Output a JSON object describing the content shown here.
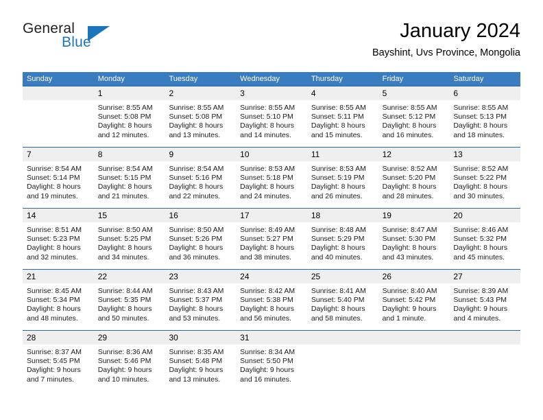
{
  "brand": {
    "word_one": "General",
    "word_two": "Blue",
    "triangle_icon": "triangle-icon"
  },
  "header": {
    "title": "January 2024",
    "subtitle": "Bayshint, Uvs Province, Mongolia"
  },
  "colors": {
    "header_blue": "#3a7cc0",
    "row_border_blue": "#2b6ca8",
    "day_number_bg": "#efefef",
    "brand_blue": "#1b75bb"
  },
  "weekdays": [
    "Sunday",
    "Monday",
    "Tuesday",
    "Wednesday",
    "Thursday",
    "Friday",
    "Saturday"
  ],
  "weeks": [
    [
      {
        "day": "",
        "sunrise": "",
        "sunset": "",
        "daylight_line1": "",
        "daylight_line2": ""
      },
      {
        "day": "1",
        "sunrise": "Sunrise: 8:55 AM",
        "sunset": "Sunset: 5:08 PM",
        "daylight_line1": "Daylight: 8 hours",
        "daylight_line2": "and 12 minutes."
      },
      {
        "day": "2",
        "sunrise": "Sunrise: 8:55 AM",
        "sunset": "Sunset: 5:08 PM",
        "daylight_line1": "Daylight: 8 hours",
        "daylight_line2": "and 13 minutes."
      },
      {
        "day": "3",
        "sunrise": "Sunrise: 8:55 AM",
        "sunset": "Sunset: 5:10 PM",
        "daylight_line1": "Daylight: 8 hours",
        "daylight_line2": "and 14 minutes."
      },
      {
        "day": "4",
        "sunrise": "Sunrise: 8:55 AM",
        "sunset": "Sunset: 5:11 PM",
        "daylight_line1": "Daylight: 8 hours",
        "daylight_line2": "and 15 minutes."
      },
      {
        "day": "5",
        "sunrise": "Sunrise: 8:55 AM",
        "sunset": "Sunset: 5:12 PM",
        "daylight_line1": "Daylight: 8 hours",
        "daylight_line2": "and 16 minutes."
      },
      {
        "day": "6",
        "sunrise": "Sunrise: 8:55 AM",
        "sunset": "Sunset: 5:13 PM",
        "daylight_line1": "Daylight: 8 hours",
        "daylight_line2": "and 18 minutes."
      }
    ],
    [
      {
        "day": "7",
        "sunrise": "Sunrise: 8:54 AM",
        "sunset": "Sunset: 5:14 PM",
        "daylight_line1": "Daylight: 8 hours",
        "daylight_line2": "and 19 minutes."
      },
      {
        "day": "8",
        "sunrise": "Sunrise: 8:54 AM",
        "sunset": "Sunset: 5:15 PM",
        "daylight_line1": "Daylight: 8 hours",
        "daylight_line2": "and 21 minutes."
      },
      {
        "day": "9",
        "sunrise": "Sunrise: 8:54 AM",
        "sunset": "Sunset: 5:16 PM",
        "daylight_line1": "Daylight: 8 hours",
        "daylight_line2": "and 22 minutes."
      },
      {
        "day": "10",
        "sunrise": "Sunrise: 8:53 AM",
        "sunset": "Sunset: 5:18 PM",
        "daylight_line1": "Daylight: 8 hours",
        "daylight_line2": "and 24 minutes."
      },
      {
        "day": "11",
        "sunrise": "Sunrise: 8:53 AM",
        "sunset": "Sunset: 5:19 PM",
        "daylight_line1": "Daylight: 8 hours",
        "daylight_line2": "and 26 minutes."
      },
      {
        "day": "12",
        "sunrise": "Sunrise: 8:52 AM",
        "sunset": "Sunset: 5:20 PM",
        "daylight_line1": "Daylight: 8 hours",
        "daylight_line2": "and 28 minutes."
      },
      {
        "day": "13",
        "sunrise": "Sunrise: 8:52 AM",
        "sunset": "Sunset: 5:22 PM",
        "daylight_line1": "Daylight: 8 hours",
        "daylight_line2": "and 30 minutes."
      }
    ],
    [
      {
        "day": "14",
        "sunrise": "Sunrise: 8:51 AM",
        "sunset": "Sunset: 5:23 PM",
        "daylight_line1": "Daylight: 8 hours",
        "daylight_line2": "and 32 minutes."
      },
      {
        "day": "15",
        "sunrise": "Sunrise: 8:50 AM",
        "sunset": "Sunset: 5:25 PM",
        "daylight_line1": "Daylight: 8 hours",
        "daylight_line2": "and 34 minutes."
      },
      {
        "day": "16",
        "sunrise": "Sunrise: 8:50 AM",
        "sunset": "Sunset: 5:26 PM",
        "daylight_line1": "Daylight: 8 hours",
        "daylight_line2": "and 36 minutes."
      },
      {
        "day": "17",
        "sunrise": "Sunrise: 8:49 AM",
        "sunset": "Sunset: 5:27 PM",
        "daylight_line1": "Daylight: 8 hours",
        "daylight_line2": "and 38 minutes."
      },
      {
        "day": "18",
        "sunrise": "Sunrise: 8:48 AM",
        "sunset": "Sunset: 5:29 PM",
        "daylight_line1": "Daylight: 8 hours",
        "daylight_line2": "and 40 minutes."
      },
      {
        "day": "19",
        "sunrise": "Sunrise: 8:47 AM",
        "sunset": "Sunset: 5:30 PM",
        "daylight_line1": "Daylight: 8 hours",
        "daylight_line2": "and 43 minutes."
      },
      {
        "day": "20",
        "sunrise": "Sunrise: 8:46 AM",
        "sunset": "Sunset: 5:32 PM",
        "daylight_line1": "Daylight: 8 hours",
        "daylight_line2": "and 45 minutes."
      }
    ],
    [
      {
        "day": "21",
        "sunrise": "Sunrise: 8:45 AM",
        "sunset": "Sunset: 5:34 PM",
        "daylight_line1": "Daylight: 8 hours",
        "daylight_line2": "and 48 minutes."
      },
      {
        "day": "22",
        "sunrise": "Sunrise: 8:44 AM",
        "sunset": "Sunset: 5:35 PM",
        "daylight_line1": "Daylight: 8 hours",
        "daylight_line2": "and 50 minutes."
      },
      {
        "day": "23",
        "sunrise": "Sunrise: 8:43 AM",
        "sunset": "Sunset: 5:37 PM",
        "daylight_line1": "Daylight: 8 hours",
        "daylight_line2": "and 53 minutes."
      },
      {
        "day": "24",
        "sunrise": "Sunrise: 8:42 AM",
        "sunset": "Sunset: 5:38 PM",
        "daylight_line1": "Daylight: 8 hours",
        "daylight_line2": "and 56 minutes."
      },
      {
        "day": "25",
        "sunrise": "Sunrise: 8:41 AM",
        "sunset": "Sunset: 5:40 PM",
        "daylight_line1": "Daylight: 8 hours",
        "daylight_line2": "and 58 minutes."
      },
      {
        "day": "26",
        "sunrise": "Sunrise: 8:40 AM",
        "sunset": "Sunset: 5:42 PM",
        "daylight_line1": "Daylight: 9 hours",
        "daylight_line2": "and 1 minute."
      },
      {
        "day": "27",
        "sunrise": "Sunrise: 8:39 AM",
        "sunset": "Sunset: 5:43 PM",
        "daylight_line1": "Daylight: 9 hours",
        "daylight_line2": "and 4 minutes."
      }
    ],
    [
      {
        "day": "28",
        "sunrise": "Sunrise: 8:37 AM",
        "sunset": "Sunset: 5:45 PM",
        "daylight_line1": "Daylight: 9 hours",
        "daylight_line2": "and 7 minutes."
      },
      {
        "day": "29",
        "sunrise": "Sunrise: 8:36 AM",
        "sunset": "Sunset: 5:46 PM",
        "daylight_line1": "Daylight: 9 hours",
        "daylight_line2": "and 10 minutes."
      },
      {
        "day": "30",
        "sunrise": "Sunrise: 8:35 AM",
        "sunset": "Sunset: 5:48 PM",
        "daylight_line1": "Daylight: 9 hours",
        "daylight_line2": "and 13 minutes."
      },
      {
        "day": "31",
        "sunrise": "Sunrise: 8:34 AM",
        "sunset": "Sunset: 5:50 PM",
        "daylight_line1": "Daylight: 9 hours",
        "daylight_line2": "and 16 minutes."
      },
      {
        "day": "",
        "sunrise": "",
        "sunset": "",
        "daylight_line1": "",
        "daylight_line2": ""
      },
      {
        "day": "",
        "sunrise": "",
        "sunset": "",
        "daylight_line1": "",
        "daylight_line2": ""
      },
      {
        "day": "",
        "sunrise": "",
        "sunset": "",
        "daylight_line1": "",
        "daylight_line2": ""
      }
    ]
  ]
}
